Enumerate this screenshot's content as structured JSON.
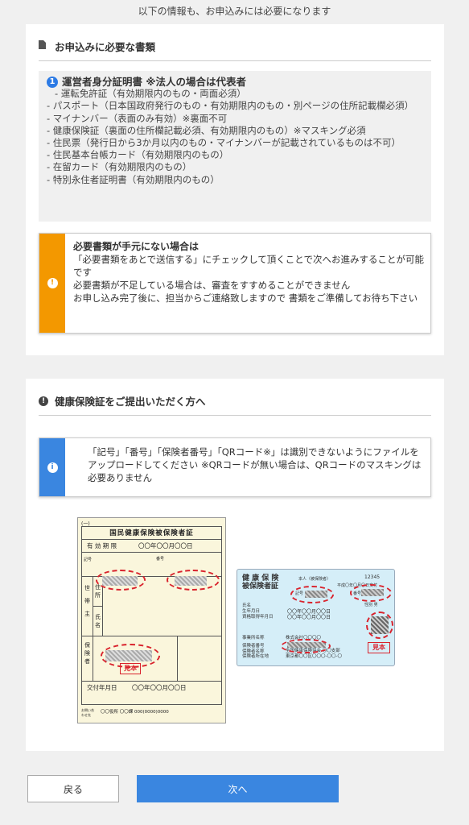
{
  "top_note": "以下の情報も、お申込みには必要になります",
  "section1": {
    "title": "お申込みに必要な書類",
    "item_number": "1",
    "item_title": "運営者身分証明書 ※法人の場合は代表者",
    "docs": [
      "- 運転免許証（有効期限内のもの・両面必須）",
      "- パスポート（日本国政府発行のもの・有効期限内のもの・別ページの住所記載欄必須）",
      "- マイナンバー（表面のみ有効）※裏面不可",
      "- 健康保険証（裏面の住所欄記載必須、有効期限内のもの）※マスキング必須",
      "- 住民票（発行日から3か月以内のもの・マイナンバーが記載されているものは不可）",
      "- 住民基本台帳カード（有効期限内のもの）",
      "- 在留カード（有効期限内のもの）",
      "- 特別永住者証明書（有効期限内のもの）"
    ],
    "warning": {
      "title": "必要書類が手元にない場合は",
      "lines": [
        "「必要書類をあとで送信する」にチェックして頂くことで次へお進みすることが可能です",
        "必要書類が不足している場合は、審査をすすめることができません",
        "お申し込み完了後に、担当からご連絡致しますので 書類をご準備してお待ち下さい"
      ]
    }
  },
  "section2": {
    "title": "健康保険証をご提出いただく方へ",
    "info": "「記号」「番号」「保険者番号」「QRコード※」は識別できないようにファイルをアップロードしてください ※QRコードが無い場合は、QRコードのマスキングは必要ありません",
    "kokuho_card": {
      "header": "(一)",
      "title": "国民健康保険被保険者証",
      "validity_label": "有 効 期 限",
      "validity_value": "〇〇年〇〇月〇〇日",
      "kigo_label": "記号",
      "bango_label": "番号",
      "setai_label": "世帯主",
      "jusho_label": "住所",
      "shimei_label": "氏名",
      "hokensha_label": "保険者",
      "issue_label": "交付年月日",
      "issue_value": "〇〇年〇〇月〇〇日",
      "footer_label": "お問い合わせ先",
      "footer_value": "〇〇役所 〇〇課 000(0000)0000",
      "stamp": "見本"
    },
    "shakai_card": {
      "title1": "健 康 保 険",
      "title2": "被保険者証",
      "honnin": "本人（被保険者）",
      "number": "12345",
      "issued": "平成〇年〇月〇日交付",
      "kigo": "記号",
      "bango": "番号",
      "shimei": "氏名",
      "seinen": "生年月日",
      "shikaku": "資格取得年月日",
      "seibetsu": "性別 男",
      "date1": "〇〇年〇〇月〇〇日",
      "date2": "〇〇年〇〇月〇〇日",
      "jigyosho": "事業所名称",
      "jigyosho_val": "株式会社〇〇〇〇",
      "hokensha_no": "保険者番号",
      "hokensha_name": "保険者名称",
      "hokensha_addr": "保険者所在地",
      "hokensha_name_val": "全国健康保険協会 〇〇支部",
      "hokensha_addr_val": "東京都〇〇区〇〇〇-〇〇-〇",
      "stamp": "見本"
    }
  },
  "buttons": {
    "back": "戻る",
    "next": "次へ"
  }
}
